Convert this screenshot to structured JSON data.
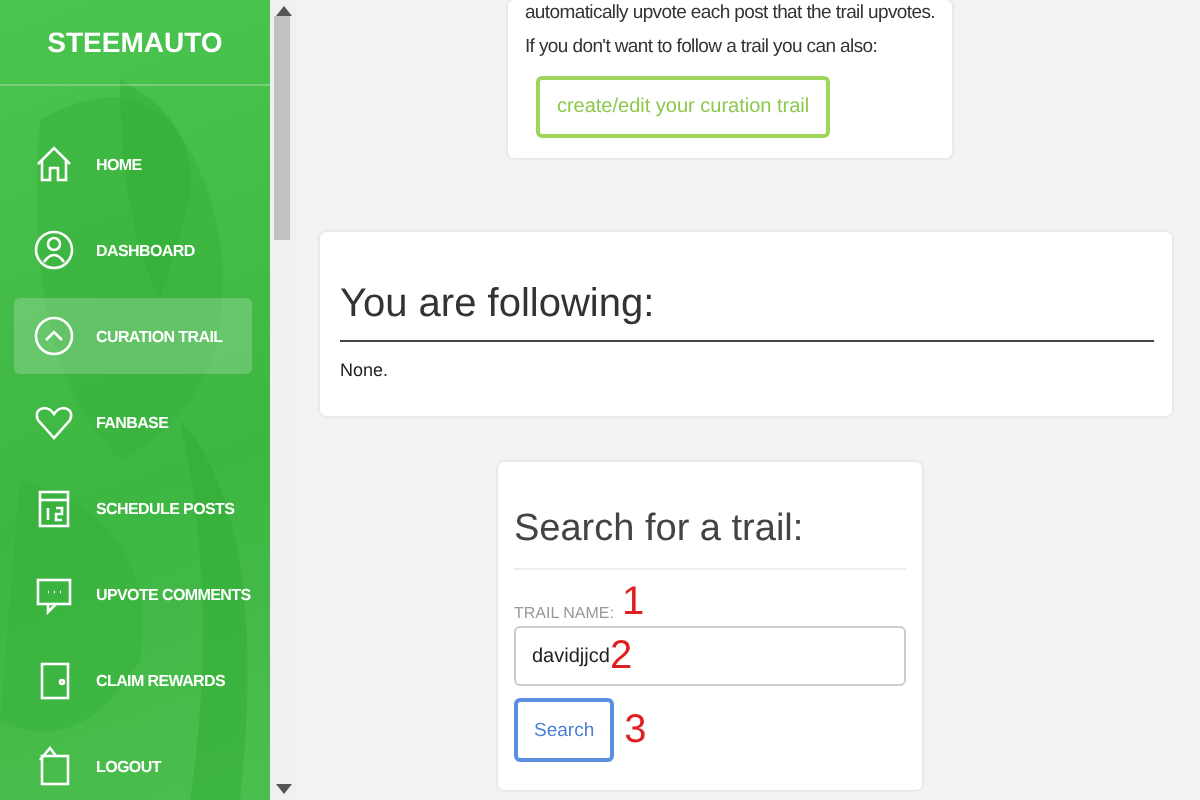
{
  "sidebar": {
    "brand": "STEEMAUTO",
    "items": [
      {
        "label": "HOME",
        "selected": false
      },
      {
        "label": "DASHBOARD",
        "selected": false
      },
      {
        "label": "CURATION TRAIL",
        "selected": true
      },
      {
        "label": "FANBASE",
        "selected": false
      },
      {
        "label": "SCHEDULE POSTS",
        "selected": false
      },
      {
        "label": "UPVOTE COMMENTS",
        "selected": false
      },
      {
        "label": "CLAIM REWARDS",
        "selected": false
      },
      {
        "label": "LOGOUT",
        "selected": false
      }
    ]
  },
  "intro_card": {
    "lines": [
      "automatically upvote each post that the trail upvotes.",
      "If you don't want to follow a trail you can also:"
    ],
    "button": "create/edit your curation trail"
  },
  "following_card": {
    "title": "You are following:",
    "text": "None."
  },
  "search_card": {
    "title": "Search for a trail:",
    "label": "TRAIL NAME:",
    "value": "davidjjcd",
    "button": "Search"
  },
  "annotations": [
    "1",
    "2",
    "3"
  ]
}
